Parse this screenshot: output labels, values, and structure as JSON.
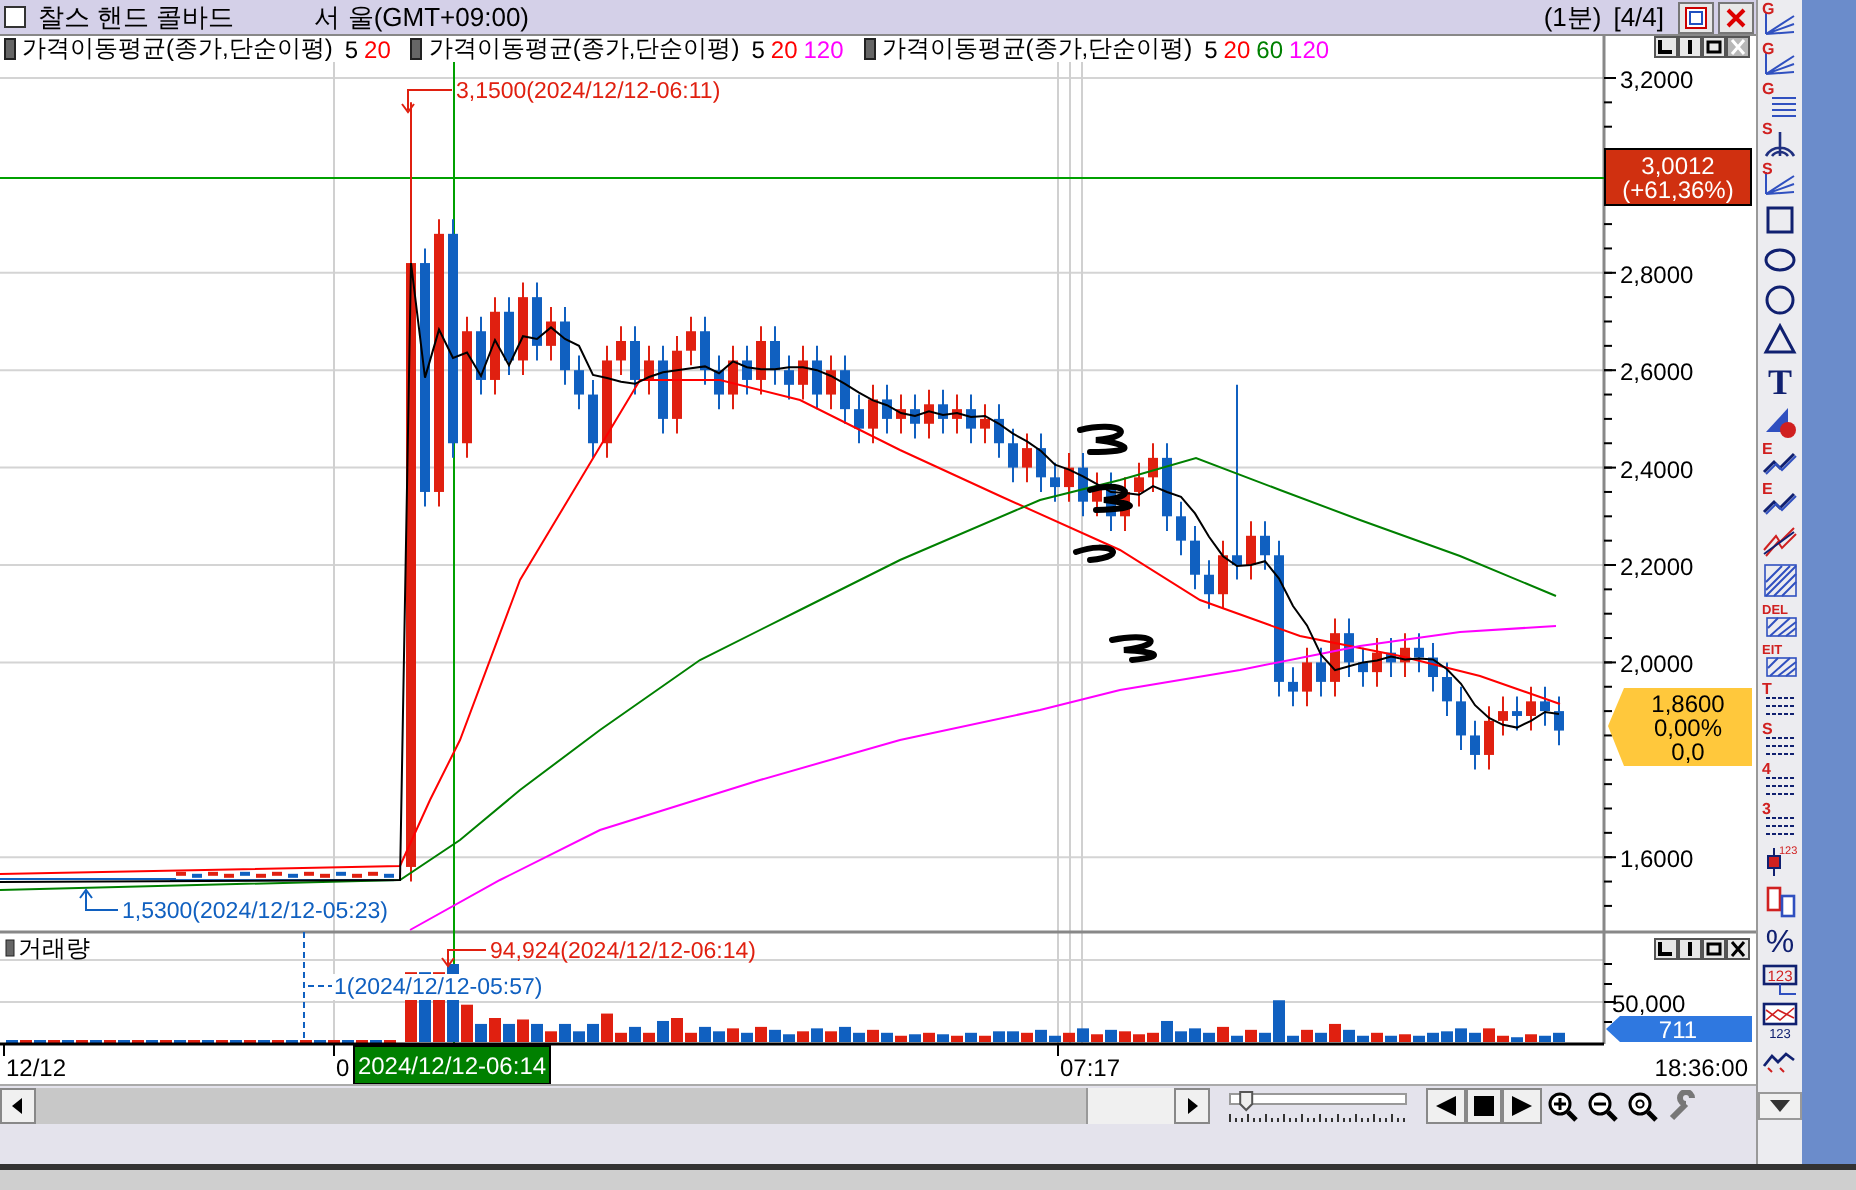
{
  "title_bar": {
    "checked": false,
    "title": "찰스 핸드 콜바드",
    "location": "서  울(GMT+09:00)",
    "interval": "(1분)",
    "page": "[4/4]"
  },
  "legend": [
    {
      "name": "가격이동평균(종가,단순이평)",
      "periods": [
        {
          "label": "5",
          "color": "#000000"
        },
        {
          "label": "20",
          "color": "#ff0000"
        }
      ]
    },
    {
      "name": "가격이동평균(종가,단순이평)",
      "periods": [
        {
          "label": "5",
          "color": "#000000"
        },
        {
          "label": "20",
          "color": "#ff0000"
        },
        {
          "label": "120",
          "color": "#ff00ff"
        }
      ]
    },
    {
      "name": "가격이동평균(종가,단순이평)",
      "periods": [
        {
          "label": "5",
          "color": "#000000"
        },
        {
          "label": "20",
          "color": "#ff0000"
        },
        {
          "label": "60",
          "color": "#008000"
        },
        {
          "label": "120",
          "color": "#ff00ff"
        }
      ]
    }
  ],
  "price_pane": {
    "axis_ticks": [
      "3,2000",
      "2,8000",
      "2,6000",
      "2,4000",
      "2,2000",
      "2,0000",
      "1,6000"
    ],
    "high_note": "3,1500(2024/12/12-06:11)",
    "low_note": "1,5300(2024/12/12-05:23)",
    "crosshair_badge": {
      "value": "3,0012",
      "change": "(+61,36%)"
    },
    "last_badge": {
      "price": "1,8600",
      "change": "0,00%",
      "volume_change": "0,0"
    }
  },
  "volume_pane": {
    "title": "거래량",
    "axis_tick": "50,000",
    "peak_note": "94,924(2024/12/12-06:14)",
    "min_note": "1(2024/12/12-05:57)",
    "last_badge": "711"
  },
  "zoom_slider": {
    "level": 0.05
  },
  "time_axis": {
    "labels": [
      "12/12",
      "0",
      "07:17"
    ],
    "crosshair_time": "2024/12/12-06:14",
    "clock": "18:36:00"
  },
  "toolbar": [
    {
      "kind": "fan",
      "label": "G"
    },
    {
      "kind": "fan",
      "label": "G"
    },
    {
      "kind": "grid",
      "label": "G"
    },
    {
      "kind": "arc",
      "label": "S"
    },
    {
      "kind": "fan",
      "label": "S"
    },
    {
      "kind": "rectangle"
    },
    {
      "kind": "ellipse"
    },
    {
      "kind": "circle"
    },
    {
      "kind": "triangle"
    },
    {
      "kind": "text",
      "label": "T"
    },
    {
      "kind": "fill"
    },
    {
      "kind": "zigzag",
      "label": "E"
    },
    {
      "kind": "zigzag",
      "label": "E"
    },
    {
      "kind": "double-zigzag"
    },
    {
      "kind": "hatch"
    },
    {
      "kind": "hatch",
      "label": "DEL"
    },
    {
      "kind": "hatch",
      "label": "EIT"
    },
    {
      "kind": "lines",
      "label": "T"
    },
    {
      "kind": "lines",
      "label": "S"
    },
    {
      "kind": "lines",
      "label": "4"
    },
    {
      "kind": "lines",
      "label": "3"
    },
    {
      "kind": "candle",
      "label": "123"
    },
    {
      "kind": "compare"
    },
    {
      "kind": "percent",
      "label": "%"
    },
    {
      "kind": "number-box",
      "label": "123"
    },
    {
      "kind": "number-chart",
      "label": "123"
    },
    {
      "kind": "small-zigzag"
    }
  ]
}
